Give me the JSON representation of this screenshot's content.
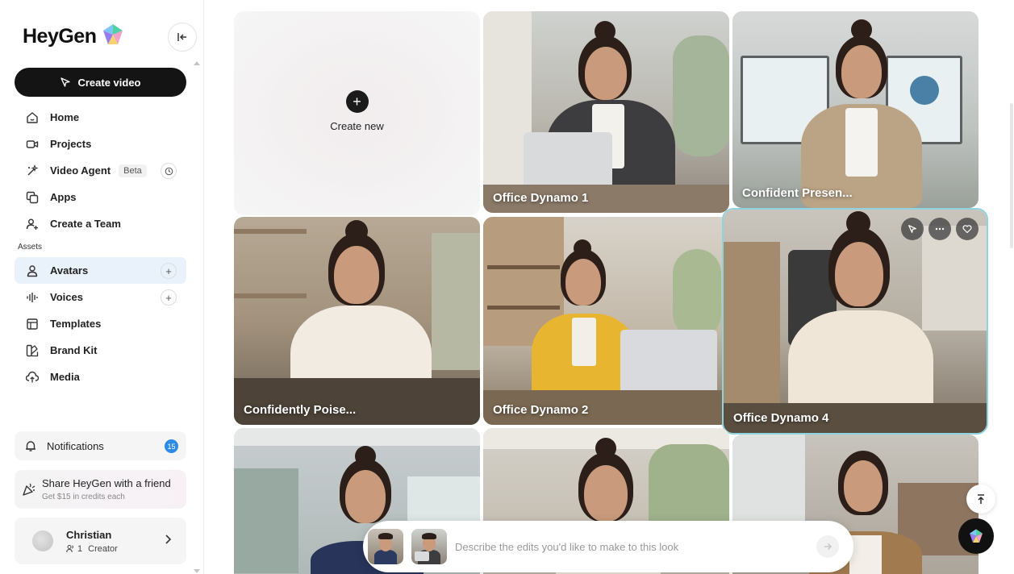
{
  "app": {
    "name": "HeyGen"
  },
  "sidebar": {
    "create_video_label": "Create video",
    "nav": [
      {
        "label": "Home",
        "icon": "home-icon"
      },
      {
        "label": "Projects",
        "icon": "projects-icon"
      },
      {
        "label": "Video Agent",
        "icon": "video-agent-icon",
        "badge": "Beta"
      },
      {
        "label": "Apps",
        "icon": "apps-icon"
      },
      {
        "label": "Create a Team",
        "icon": "add-team-icon"
      }
    ],
    "assets_label": "Assets",
    "assets": [
      {
        "label": "Avatars",
        "icon": "avatar-icon",
        "active": true
      },
      {
        "label": "Voices",
        "icon": "voices-icon"
      },
      {
        "label": "Templates",
        "icon": "templates-icon"
      },
      {
        "label": "Brand Kit",
        "icon": "brand-kit-icon"
      },
      {
        "label": "Media",
        "icon": "media-icon"
      }
    ],
    "notifications": {
      "label": "Notifications",
      "count": "15"
    },
    "share": {
      "title": "Share HeyGen with a friend",
      "subtitle": "Get $15 in credits each"
    },
    "profile": {
      "name": "Christian",
      "member_count": "1",
      "role": "Creator"
    }
  },
  "grid": {
    "create_new_label": "Create new",
    "cards": [
      {
        "label": "Office Dynamo 1"
      },
      {
        "label": "Confident Presen..."
      },
      {
        "label": "Confidently Poise..."
      },
      {
        "label": "Office Dynamo 2"
      },
      {
        "label": "Office Dynamo 4",
        "selected": true
      },
      {
        "label": ""
      },
      {
        "label": ""
      },
      {
        "label": ""
      }
    ]
  },
  "prompt": {
    "placeholder": "Describe the edits you'd like to make to this look"
  },
  "colors": {
    "accent": "#2d8be8",
    "dark": "#141414",
    "active_bg": "#e9f1fb",
    "selected_outline": "#8fd3e0"
  }
}
